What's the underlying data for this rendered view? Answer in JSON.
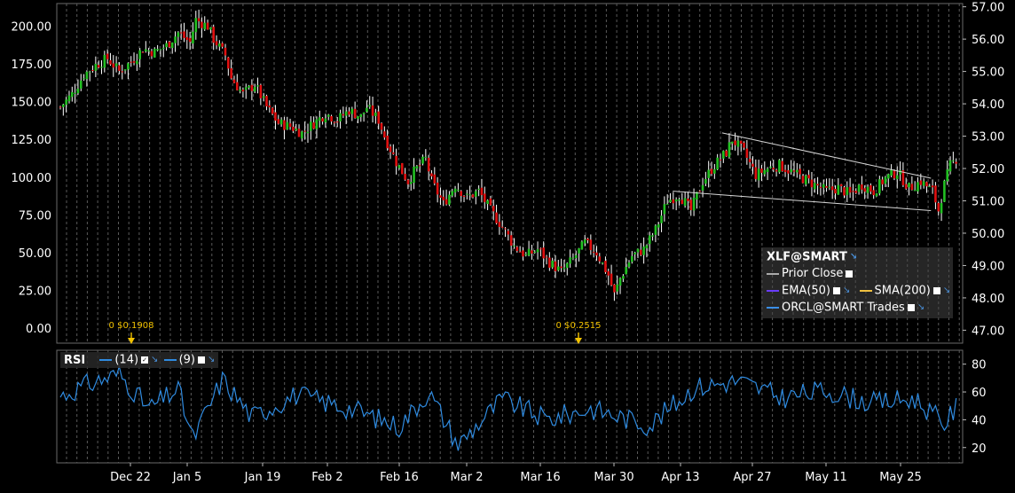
{
  "chart_data": [
    {
      "type": "candlestick",
      "symbol": "XLF@SMART",
      "left_axis": {
        "ticks": [
          "200.00",
          "175.00",
          "150.00",
          "125.00",
          "100.00",
          "75.00",
          "50.00",
          "25.00",
          "0.00"
        ],
        "range": [
          -10,
          215
        ]
      },
      "right_axis": {
        "ticks": [
          "57.00",
          "56.00",
          "55.00",
          "54.00",
          "53.00",
          "52.00",
          "51.00",
          "50.00",
          "49.00",
          "48.00",
          "47.00"
        ],
        "range": [
          46.6,
          57.1
        ]
      },
      "x_ticks": [
        "Dec 22",
        "Jan 5",
        "Jan 19",
        "Feb 2",
        "Feb 16",
        "Mar 2",
        "Mar 16",
        "Mar 30",
        "Apr 13",
        "Apr 27",
        "May 11",
        "May 25"
      ],
      "trend_series_right": [
        [
          0,
          53.9
        ],
        [
          4,
          54.3
        ],
        [
          8,
          54.9
        ],
        [
          12,
          55.2
        ],
        [
          16,
          55.4
        ],
        [
          20,
          55.0
        ],
        [
          24,
          55.3
        ],
        [
          28,
          55.7
        ],
        [
          32,
          55.6
        ],
        [
          36,
          55.8
        ],
        [
          40,
          56.2
        ],
        [
          44,
          55.9
        ],
        [
          46,
          56.6
        ],
        [
          50,
          56.4
        ],
        [
          52,
          56.0
        ],
        [
          56,
          55.5
        ],
        [
          58,
          54.8
        ],
        [
          62,
          54.3
        ],
        [
          66,
          54.6
        ],
        [
          70,
          53.9
        ],
        [
          74,
          53.4
        ],
        [
          78,
          53.3
        ],
        [
          82,
          53.1
        ],
        [
          86,
          53.4
        ],
        [
          90,
          53.7
        ],
        [
          94,
          53.5
        ],
        [
          98,
          53.8
        ],
        [
          102,
          53.6
        ],
        [
          104,
          53.9
        ],
        [
          108,
          53.5
        ],
        [
          110,
          53.0
        ],
        [
          114,
          52.2
        ],
        [
          118,
          51.6
        ],
        [
          120,
          51.9
        ],
        [
          124,
          52.3
        ],
        [
          126,
          51.6
        ],
        [
          130,
          50.9
        ],
        [
          134,
          51.5
        ],
        [
          138,
          51.1
        ],
        [
          142,
          51.3
        ],
        [
          146,
          50.7
        ],
        [
          150,
          50.2
        ],
        [
          154,
          49.6
        ],
        [
          158,
          49.3
        ],
        [
          162,
          49.5
        ],
        [
          166,
          49.1
        ],
        [
          170,
          48.8
        ],
        [
          174,
          49.2
        ],
        [
          178,
          49.7
        ],
        [
          182,
          49.4
        ],
        [
          186,
          48.7
        ],
        [
          188,
          48.1
        ],
        [
          190,
          48.6
        ],
        [
          194,
          49.3
        ],
        [
          198,
          49.5
        ],
        [
          202,
          50.1
        ],
        [
          206,
          51.0
        ],
        [
          210,
          51.2
        ],
        [
          214,
          50.7
        ],
        [
          218,
          51.6
        ],
        [
          222,
          52.1
        ],
        [
          226,
          52.5
        ],
        [
          228,
          52.9
        ],
        [
          232,
          52.5
        ],
        [
          236,
          51.8
        ],
        [
          240,
          52.0
        ],
        [
          244,
          52.1
        ],
        [
          248,
          51.9
        ],
        [
          252,
          51.7
        ],
        [
          256,
          51.5
        ],
        [
          260,
          51.3
        ],
        [
          264,
          51.4
        ],
        [
          268,
          51.2
        ],
        [
          272,
          51.5
        ],
        [
          276,
          51.3
        ],
        [
          280,
          51.7
        ],
        [
          284,
          51.9
        ],
        [
          288,
          51.4
        ],
        [
          292,
          51.6
        ],
        [
          296,
          51.3
        ],
        [
          298,
          50.7
        ],
        [
          300,
          51.5
        ],
        [
          302,
          52.1
        ],
        [
          304,
          52.3
        ]
      ],
      "trendlines": [
        {
          "from": [
            0.6675,
            52.1
          ],
          "to": [
            0.965,
            51.7
          ]
        },
        {
          "from": [
            0.68,
            51.3
          ],
          "to": [
            0.965,
            50.7
          ]
        }
      ],
      "dividends": [
        {
          "x": "Dec 22",
          "label": "0 $0.1908"
        },
        {
          "x": "Mar 23",
          "label": "0 $0.2515"
        }
      ],
      "legend": {
        "title": "XLF@SMART",
        "items": [
          {
            "name": "Prior Close",
            "color": "#aaaaaa"
          },
          {
            "name": "EMA(50)",
            "color": "#6a3cff"
          },
          {
            "name": "SMA(200)",
            "color": "#f0c040"
          },
          {
            "name": "ORCL@SMART Trades",
            "color": "#3a8ee6"
          }
        ]
      },
      "colors": {
        "up": "#22c022",
        "down": "#e01010",
        "wick": "#ffffff",
        "channel": "#d8d8d8",
        "grid": "#5a5a5a",
        "dividend": "#f2c200"
      }
    },
    {
      "type": "line",
      "title": "RSI",
      "y_ticks": [
        "80",
        "60",
        "40",
        "20"
      ],
      "ylim": [
        9,
        90
      ],
      "series": [
        {
          "name": "(14)",
          "color": "#2f8be0"
        },
        {
          "name": "(9)",
          "color": "#2f8be0"
        }
      ],
      "anchors": [
        [
          0,
          57
        ],
        [
          10,
          66
        ],
        [
          20,
          73
        ],
        [
          30,
          48
        ],
        [
          40,
          62
        ],
        [
          45,
          26
        ],
        [
          55,
          69
        ],
        [
          65,
          42
        ],
        [
          80,
          58
        ],
        [
          100,
          47
        ],
        [
          115,
          35
        ],
        [
          125,
          60
        ],
        [
          135,
          22
        ],
        [
          150,
          55
        ],
        [
          165,
          40
        ],
        [
          180,
          48
        ],
        [
          200,
          36
        ],
        [
          215,
          63
        ],
        [
          230,
          68
        ],
        [
          245,
          56
        ],
        [
          260,
          61
        ],
        [
          275,
          52
        ],
        [
          290,
          55
        ],
        [
          300,
          37
        ],
        [
          310,
          67
        ]
      ]
    }
  ]
}
